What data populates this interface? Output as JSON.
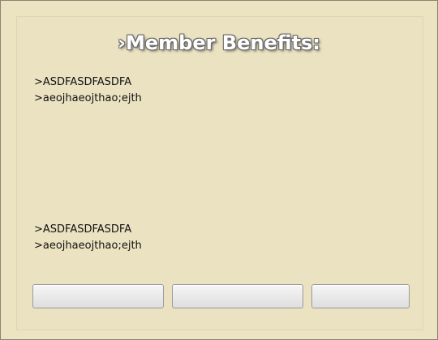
{
  "title": "›Member Benefits:",
  "benefits_top": [
    ">ASDFASDFASDFA",
    ">aeojhaeojthao;ejth"
  ],
  "benefits_bottom": [
    ">ASDFASDFASDFA",
    ">aeojhaeojthao;ejth"
  ],
  "buttons": [
    "",
    "",
    ""
  ]
}
